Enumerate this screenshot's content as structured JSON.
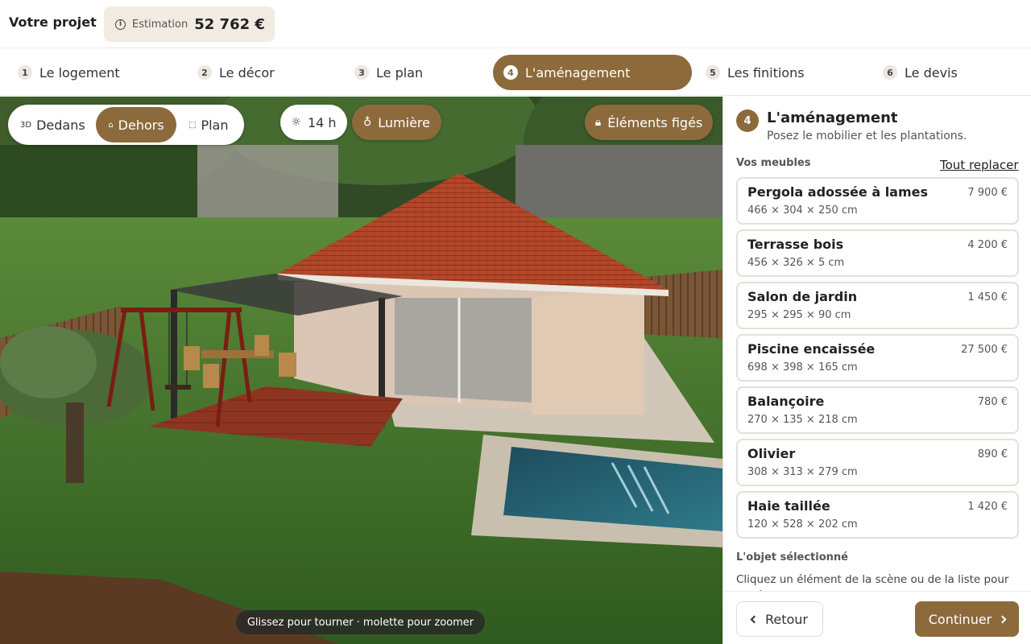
{
  "header": {
    "project_title": "Votre projet",
    "estimate_label": "Estimation",
    "estimate_value": "52 762 €"
  },
  "steps": [
    {
      "num": "1",
      "label": "Le logement"
    },
    {
      "num": "2",
      "label": "Le décor"
    },
    {
      "num": "3",
      "label": "Le plan"
    },
    {
      "num": "4",
      "label": "L'aménagement",
      "active": true
    },
    {
      "num": "5",
      "label": "Les finitions"
    },
    {
      "num": "6",
      "label": "Le devis"
    }
  ],
  "viewport": {
    "view_modes": [
      {
        "label": "Dedans",
        "icon": "3d-icon"
      },
      {
        "label": "Dehors",
        "icon": "house-icon",
        "active": true
      },
      {
        "label": "Plan",
        "icon": "plan-icon"
      }
    ],
    "time_label": "14 h",
    "light_label": "Lumière",
    "frozen_label": "Éléments figés",
    "hint": "Glissez pour tourner · molette pour zoomer"
  },
  "panel": {
    "step_num": "4",
    "title": "L'aménagement",
    "subtitle": "Posez le mobilier et les plantations.",
    "furniture_heading": "Vos meubles",
    "replace_all": "Tout replacer",
    "items": [
      {
        "name": "Pergola adossée à lames",
        "price": "7 900 €",
        "dims": "466 × 304 × 250 cm"
      },
      {
        "name": "Terrasse bois",
        "price": "4 200 €",
        "dims": "456 × 326 × 5 cm"
      },
      {
        "name": "Salon de jardin",
        "price": "1 450 €",
        "dims": "295 × 295 × 90 cm"
      },
      {
        "name": "Piscine encaissée",
        "price": "27 500 €",
        "dims": "698 × 398 × 165 cm"
      },
      {
        "name": "Balançoire",
        "price": "780 €",
        "dims": "270 × 135 × 218 cm"
      },
      {
        "name": "Olivier",
        "price": "890 €",
        "dims": "308 × 313 × 279 cm"
      },
      {
        "name": "Haie taillée",
        "price": "1 420 €",
        "dims": "120 × 528 × 202 cm"
      }
    ],
    "selected_heading": "L'objet sélectionné",
    "selected_help": "Cliquez un élément de la scène ou de la liste pour le déplacer.",
    "back_label": "Retour",
    "next_label": "Continuer"
  },
  "colors": {
    "accent": "#8c6a3c",
    "accent_light": "#f1ebe2"
  }
}
